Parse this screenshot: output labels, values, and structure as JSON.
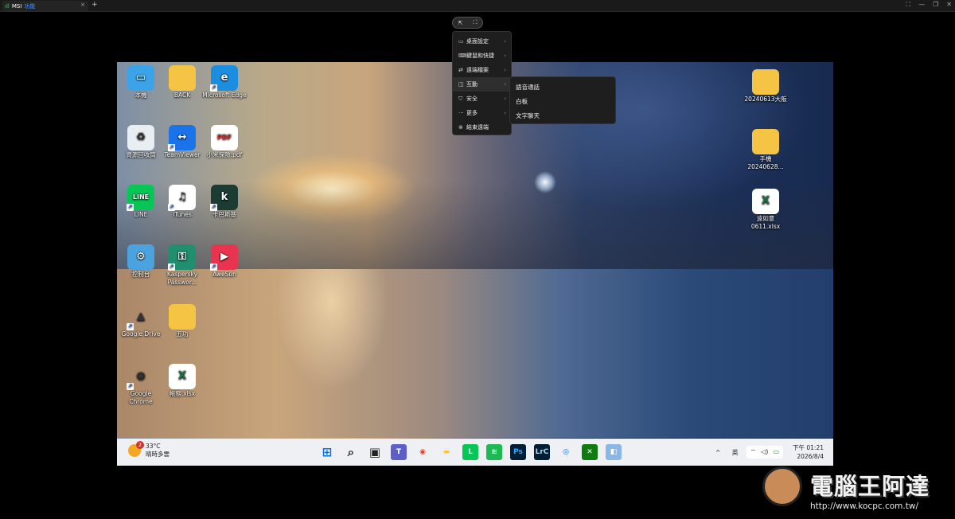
{
  "window": {
    "tab_signal": "ıll",
    "tab_name": "MSI",
    "tab_sub": "功能",
    "tab_close": "×",
    "new_tab": "+",
    "controls": [
      "⛶",
      "—",
      "❐",
      "✕"
    ]
  },
  "floatbar": {
    "pointer": "⇱",
    "fullscreen": "⛶"
  },
  "menu": {
    "items": [
      {
        "icon": "▭",
        "label": "桌面設定",
        "arrow": "›"
      },
      {
        "icon": "⌨",
        "label": "鍵鼠和快捷",
        "arrow": "›"
      },
      {
        "icon": "⇄",
        "label": "遠端檔案",
        "arrow": "›"
      },
      {
        "icon": "◫",
        "label": "互動",
        "arrow": "›"
      },
      {
        "icon": "⛉",
        "label": "安全",
        "arrow": "›"
      },
      {
        "icon": "···",
        "label": "更多",
        "arrow": "›"
      },
      {
        "icon": "⊗",
        "label": "結束遠端",
        "arrow": ""
      }
    ],
    "submenu": [
      "語音通話",
      "白板",
      "文字聊天"
    ]
  },
  "desktop_icons": [
    {
      "label": "本機",
      "glyph": "▭",
      "bg": "#3ba3e8"
    },
    {
      "label": "BACK",
      "glyph": "",
      "bg": "#f6c445"
    },
    {
      "label": "Microsoft Edge",
      "glyph": "e",
      "bg": "#1b8ee0"
    },
    {
      "label": "資源回收筒",
      "glyph": "♻",
      "bg": "#e9eef3"
    },
    {
      "label": "TeamViewer",
      "glyph": "↔",
      "bg": "#1a73e8"
    },
    {
      "label": "小米保險.pdf",
      "glyph": "PDF",
      "bg": "#ffffff"
    },
    {
      "label": "LINE",
      "glyph": "LINE",
      "bg": "#06c755"
    },
    {
      "label": "iTunes",
      "glyph": "♫",
      "bg": "#ffffff"
    },
    {
      "label": "卡巴斯基",
      "glyph": "k",
      "bg": "#1b3b33"
    },
    {
      "label": "控制台",
      "glyph": "⚙",
      "bg": "#4aa3df"
    },
    {
      "label": "Kaspersky Passwor...",
      "glyph": "⚿",
      "bg": "#1f8f6f"
    },
    {
      "label": "AweSun",
      "glyph": "▶",
      "bg": "#e8344e"
    },
    {
      "label": "Google Drive",
      "glyph": "▲",
      "bg": "transparent"
    },
    {
      "label": "五功",
      "glyph": "",
      "bg": "#f6c445"
    },
    {
      "label": "Google Chrome",
      "glyph": "◉",
      "bg": "transparent"
    },
    {
      "label": "帳務.xlsx",
      "glyph": "X",
      "bg": "#ffffff"
    },
    {
      "label": "20240613大阪",
      "glyph": "",
      "bg": "#f6c445"
    },
    {
      "label": "手機 20240628...",
      "glyph": "",
      "bg": "#f6c445"
    },
    {
      "label": "遠如意 0611.xlsx",
      "glyph": "X",
      "bg": "#ffffff"
    }
  ],
  "shortcut_arrow": "↗",
  "taskbar": {
    "weather_badge": "2",
    "temp": "33°C",
    "condition": "晴時多雲",
    "apps": [
      {
        "name": "start",
        "glyph": "⊞",
        "color": "#0a6fd6",
        "bg": "transparent"
      },
      {
        "name": "search",
        "glyph": "⌕",
        "color": "#222",
        "bg": "transparent"
      },
      {
        "name": "taskview",
        "glyph": "▣",
        "color": "#222",
        "bg": "transparent"
      },
      {
        "name": "teams",
        "glyph": "T",
        "color": "#fff",
        "bg": "#5b5fc7"
      },
      {
        "name": "chrome",
        "glyph": "◉",
        "color": "#e34133",
        "bg": "transparent"
      },
      {
        "name": "explorer",
        "glyph": "▬",
        "color": "#f6c445",
        "bg": "transparent"
      },
      {
        "name": "line",
        "glyph": "L",
        "color": "#fff",
        "bg": "#06c755"
      },
      {
        "name": "spotify",
        "glyph": "≋",
        "color": "#fff",
        "bg": "#1db954"
      },
      {
        "name": "photoshop",
        "glyph": "Ps",
        "color": "#31a8ff",
        "bg": "#001e36"
      },
      {
        "name": "lightroom",
        "glyph": "LrC",
        "color": "#add5ec",
        "bg": "#001e36"
      },
      {
        "name": "chrome-beta",
        "glyph": "◎",
        "color": "#1a73e8",
        "bg": "transparent"
      },
      {
        "name": "xbox",
        "glyph": "✕",
        "color": "#fff",
        "bg": "#107c10"
      },
      {
        "name": "app",
        "glyph": "◧",
        "color": "#fff",
        "bg": "#8ab8e6"
      }
    ],
    "tray": {
      "chevron": "^",
      "ime": "英",
      "wifi": "⌔",
      "volume": "◁)",
      "battery": "▭"
    },
    "time": "下午 01:21",
    "date": "2026/8/4"
  },
  "watermark": {
    "title": "電腦王阿達",
    "url": "http://www.kocpc.com.tw/"
  }
}
